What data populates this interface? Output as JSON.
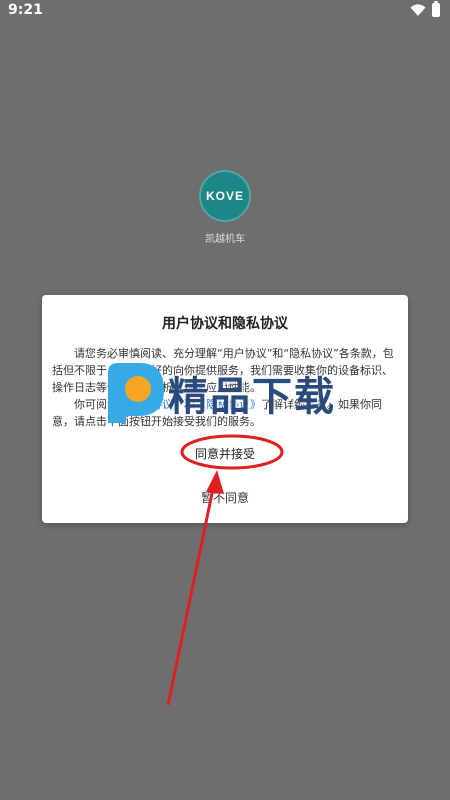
{
  "status_bar": {
    "time": "9:21",
    "icons": [
      "wifi-icon",
      "battery-icon"
    ]
  },
  "app": {
    "logo_text": "KOVE",
    "name": "凯越机车"
  },
  "dialog": {
    "title": "用户协议和隐私协议",
    "paragraph1": "请您务必审慎阅读、充分理解“用户协议”和“隐私协议”各条款，包括但不限于：为了更好的向你提供服务，我们需要收集你的设备标识、操作日志等信息用于分析、优化应用性能。",
    "paragraph2_start": "你可阅读",
    "link_user": "《用户协议》",
    "paragraph2_mid": "和",
    "link_privacy": "《隐私协议》",
    "paragraph2_end": "了解详细信息。如果你同意，请点击下面按钮开始接受我们的服务。",
    "agree_label": "同意并接受",
    "disagree_label": "暂不同意"
  },
  "watermark": {
    "text": "精品下载"
  },
  "colors": {
    "overlay": "#6e6e6e",
    "logo": "#1c8786",
    "link": "#2a7bd6",
    "annotation": "#e02020"
  }
}
